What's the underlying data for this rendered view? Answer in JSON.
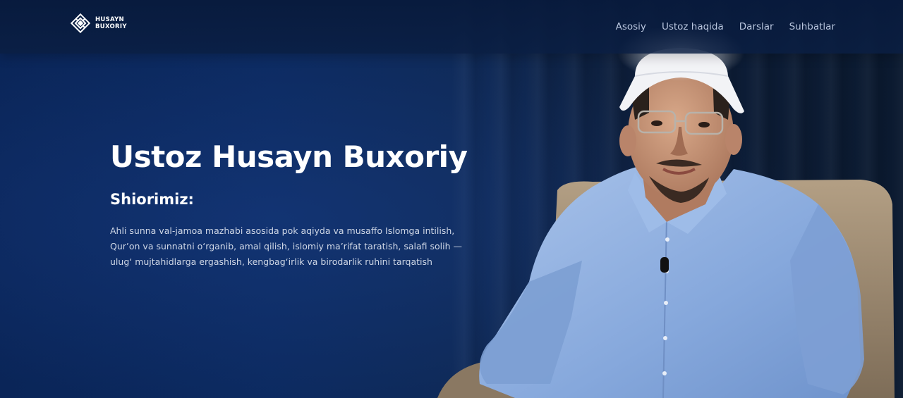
{
  "brand": {
    "line1": "HUSAYN",
    "line2": "BUXORIY",
    "icon": "kufic-square-logo-icon"
  },
  "nav": {
    "items": [
      {
        "label": "Asosiy"
      },
      {
        "label": "Ustoz haqida"
      },
      {
        "label": "Darslar"
      },
      {
        "label": "Suhbatlar"
      }
    ]
  },
  "hero": {
    "title": "Ustoz Husayn Buxoriy",
    "subtitle": "Shiorimiz:",
    "lines": [
      "Ahli sunna val-jamoa mazhabi asosida pok aqiyda va musaffo Islomga intilish,",
      "Qur’on va sunnatni o‘rganib, amal qilish, islomiy ma’rifat taratish, salafi solih —",
      "ulug‘ mujtahidlarga ergashish, kengbag‘irlik va birodarlik ruhini tarqatish"
    ]
  },
  "colors": {
    "background": "#0b2456",
    "nav_text": "#b9c6de",
    "shirt": "#8fb0e0",
    "chair": "#a4927a"
  }
}
